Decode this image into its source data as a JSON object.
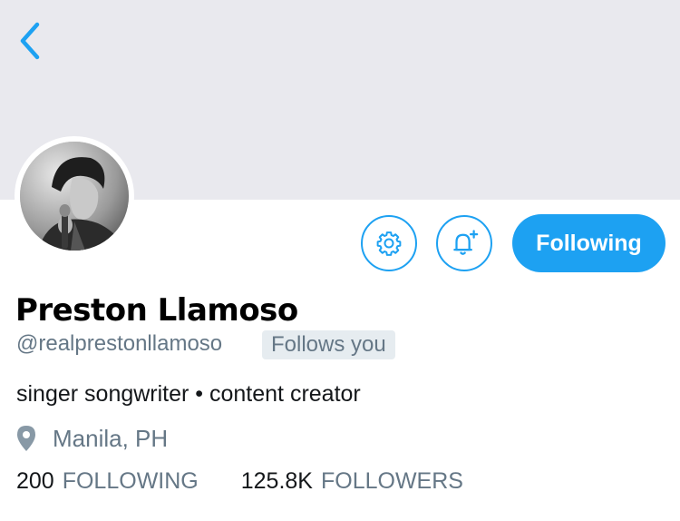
{
  "profile": {
    "display_name": "Preston Llamoso",
    "handle": "@realprestonllamoso",
    "follows_you": "Follows you",
    "bio": "singer songwriter • content creator",
    "location": "Manila, PH"
  },
  "stats": {
    "following_count": "200",
    "following_label": "FOLLOWING",
    "followers_count": "125.8K",
    "followers_label": "FOLLOWERS"
  },
  "actions": {
    "following_label": "Following"
  },
  "icons": {
    "back": "chevron-left-icon",
    "settings": "gear-icon",
    "notify": "bell-plus-icon",
    "location": "map-pin-icon"
  },
  "colors": {
    "accent": "#1da1f2",
    "banner": "#e9e9ee",
    "secondary_text": "#657786",
    "badge_bg": "#e6ecf0"
  }
}
